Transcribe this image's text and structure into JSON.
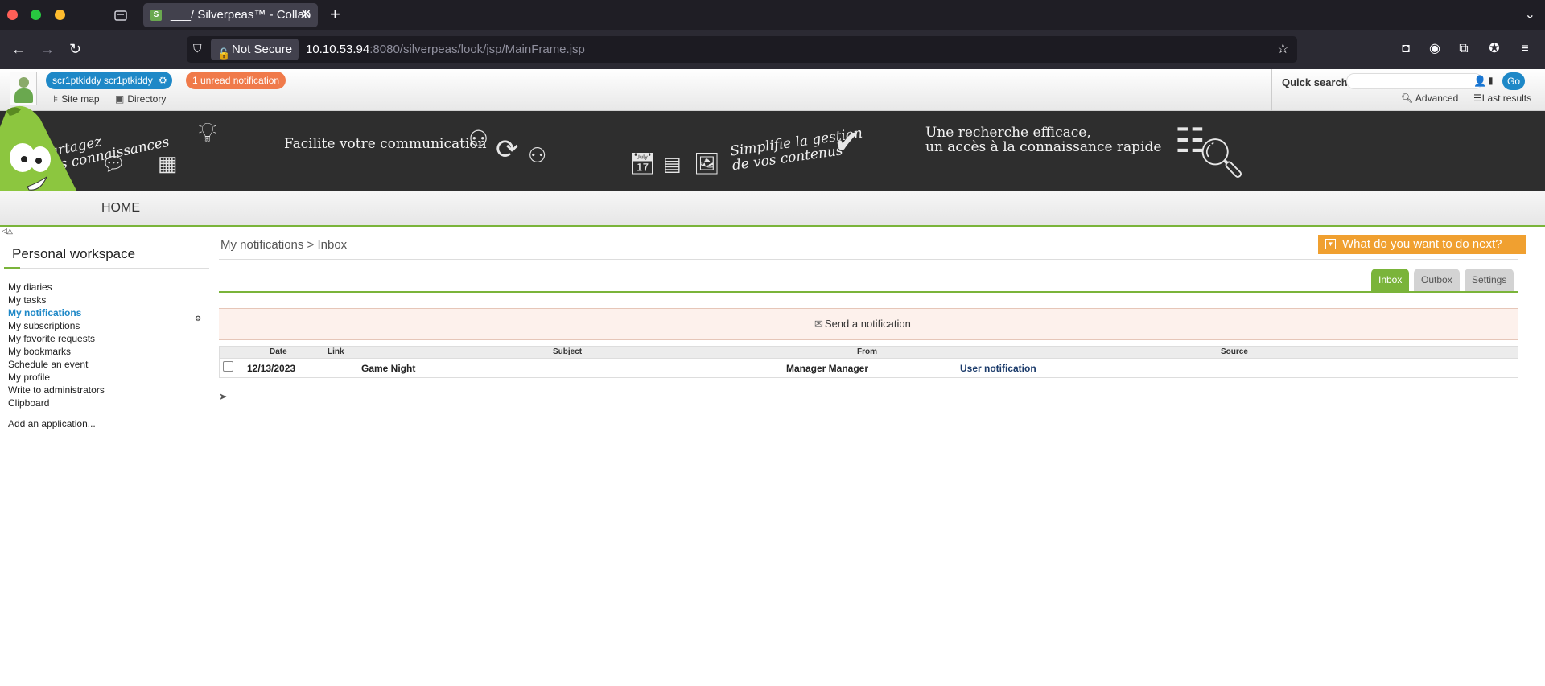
{
  "browser": {
    "tab_title": "___/ Silverpeas™ - Collab",
    "tab_favicon": "S",
    "url_security": "Not Secure",
    "url_host": "10.10.53.94",
    "url_rest": ":8080/silverpeas/look/jsp/MainFrame.jsp",
    "icons": [
      "back-icon",
      "forward-icon",
      "reload-icon",
      "star-icon",
      "pocket-icon",
      "account-icon",
      "extensions-icon",
      "menu-icon"
    ]
  },
  "header": {
    "user_name": "scr1ptkiddy scr1ptkiddy",
    "notification_badge": "1 unread notification",
    "site_map": "Site map",
    "directory": "Directory",
    "quick_search_label": "Quick search",
    "go": "Go",
    "advanced": "Advanced",
    "last_results": "Last results"
  },
  "banner": {
    "t1_line1": "Partagez",
    "t1_line2": "vos connaissances",
    "t2": "Facilite votre communication",
    "t3_line1": "Simplifie la gestion",
    "t3_line2": "de vos contenus",
    "t4_line1": "Une recherche efficace,",
    "t4_line2": "un accès à la connaissance rapide"
  },
  "menu": {
    "home": "HOME"
  },
  "sidebar": {
    "title": "Personal workspace",
    "items": [
      {
        "label": "My diaries"
      },
      {
        "label": "My tasks"
      },
      {
        "label": "My notifications"
      },
      {
        "label": "My subscriptions"
      },
      {
        "label": "My favorite requests"
      },
      {
        "label": "My bookmarks"
      },
      {
        "label": "Schedule an event"
      },
      {
        "label": "My profile"
      },
      {
        "label": "Write to administrators"
      },
      {
        "label": "Clipboard"
      }
    ],
    "add_application": "Add an application..."
  },
  "main": {
    "breadcrumb_part1": "My notifications",
    "breadcrumb_sep": ">",
    "breadcrumb_part2": "Inbox",
    "what_next": "What do you want to do next?",
    "tabs": [
      {
        "label": "Inbox"
      },
      {
        "label": "Outbox"
      },
      {
        "label": "Settings"
      }
    ],
    "send_notification": "Send a notification",
    "columns": {
      "date": "Date",
      "link": "Link",
      "subject": "Subject",
      "from": "From",
      "source": "Source"
    },
    "rows": [
      {
        "date": "12/13/2023",
        "subject": "Game Night",
        "from": "Manager Manager",
        "source": "User notification"
      }
    ]
  },
  "colors": {
    "accent_green": "#7ab43a",
    "accent_blue": "#1e88c7",
    "accent_orange": "#f0a030"
  }
}
